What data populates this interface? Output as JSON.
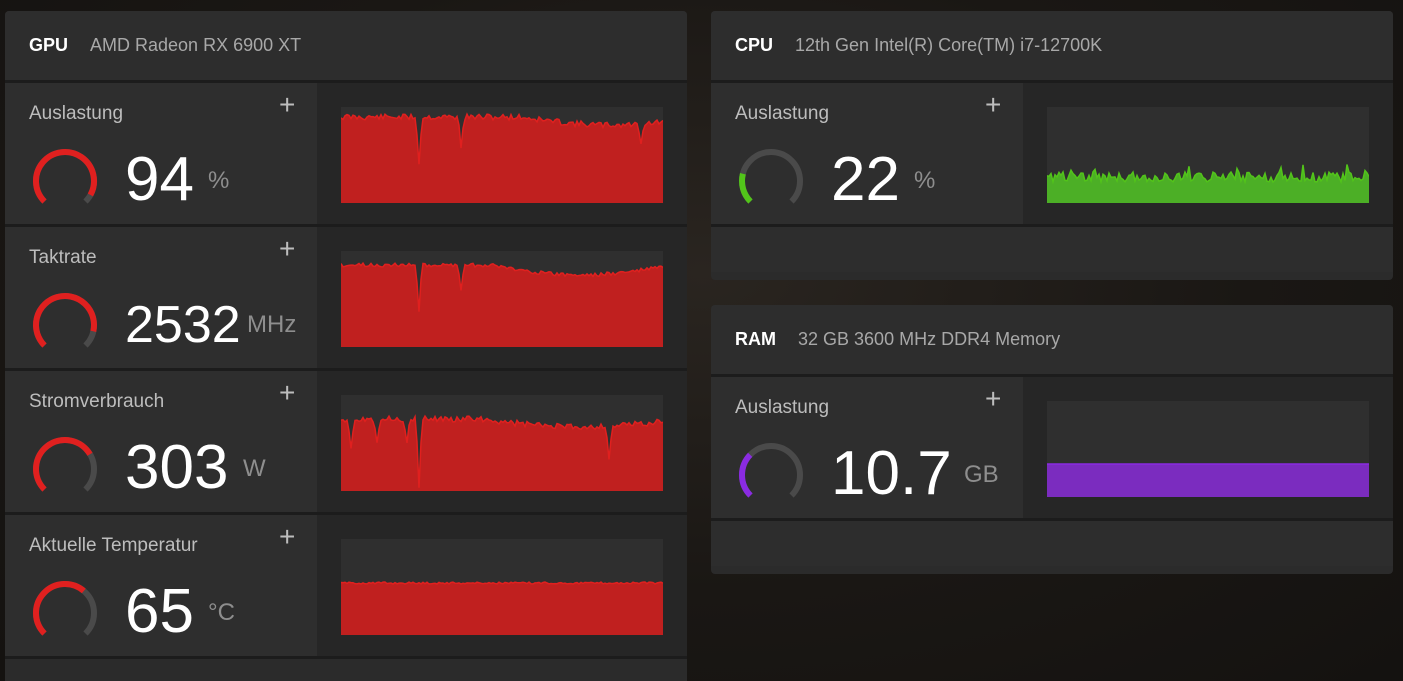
{
  "gpu": {
    "kind": "GPU",
    "model": "AMD Radeon RX 6900 XT",
    "metrics": [
      {
        "label": "Auslastung",
        "value": "94",
        "unit": "%",
        "fraction": 0.94,
        "color": "#e0201f",
        "fill": "#c0201f"
      },
      {
        "label": "Taktrate",
        "value": "2532",
        "unit": "MHz",
        "fraction": 0.88,
        "color": "#e0201f",
        "fill": "#c0201f"
      },
      {
        "label": "Stromverbrauch",
        "value": "303",
        "unit": "W",
        "fraction": 0.72,
        "color": "#e0201f",
        "fill": "#c0201f"
      },
      {
        "label": "Aktuelle Temperatur",
        "value": "65",
        "unit": "°C",
        "fraction": 0.65,
        "color": "#e0201f",
        "fill": "#c0201f"
      }
    ]
  },
  "cpu": {
    "kind": "CPU",
    "model": "12th Gen Intel(R) Core(TM) i7-12700K",
    "metrics": [
      {
        "label": "Auslastung",
        "value": "22",
        "unit": "%",
        "fraction": 0.22,
        "color": "#52c41a",
        "fill": "#4caf26"
      }
    ]
  },
  "ram": {
    "kind": "RAM",
    "model": "32 GB 3600 MHz DDR4 Memory",
    "metrics": [
      {
        "label": "Auslastung",
        "value": "10.7",
        "unit": "GB",
        "fraction": 0.33,
        "color": "#8a2be2",
        "fill": "#7b2cbf"
      }
    ]
  },
  "icons": {
    "add": "plus-icon",
    "gauge": "gauge-ring-icon"
  },
  "add_symbol": "+"
}
